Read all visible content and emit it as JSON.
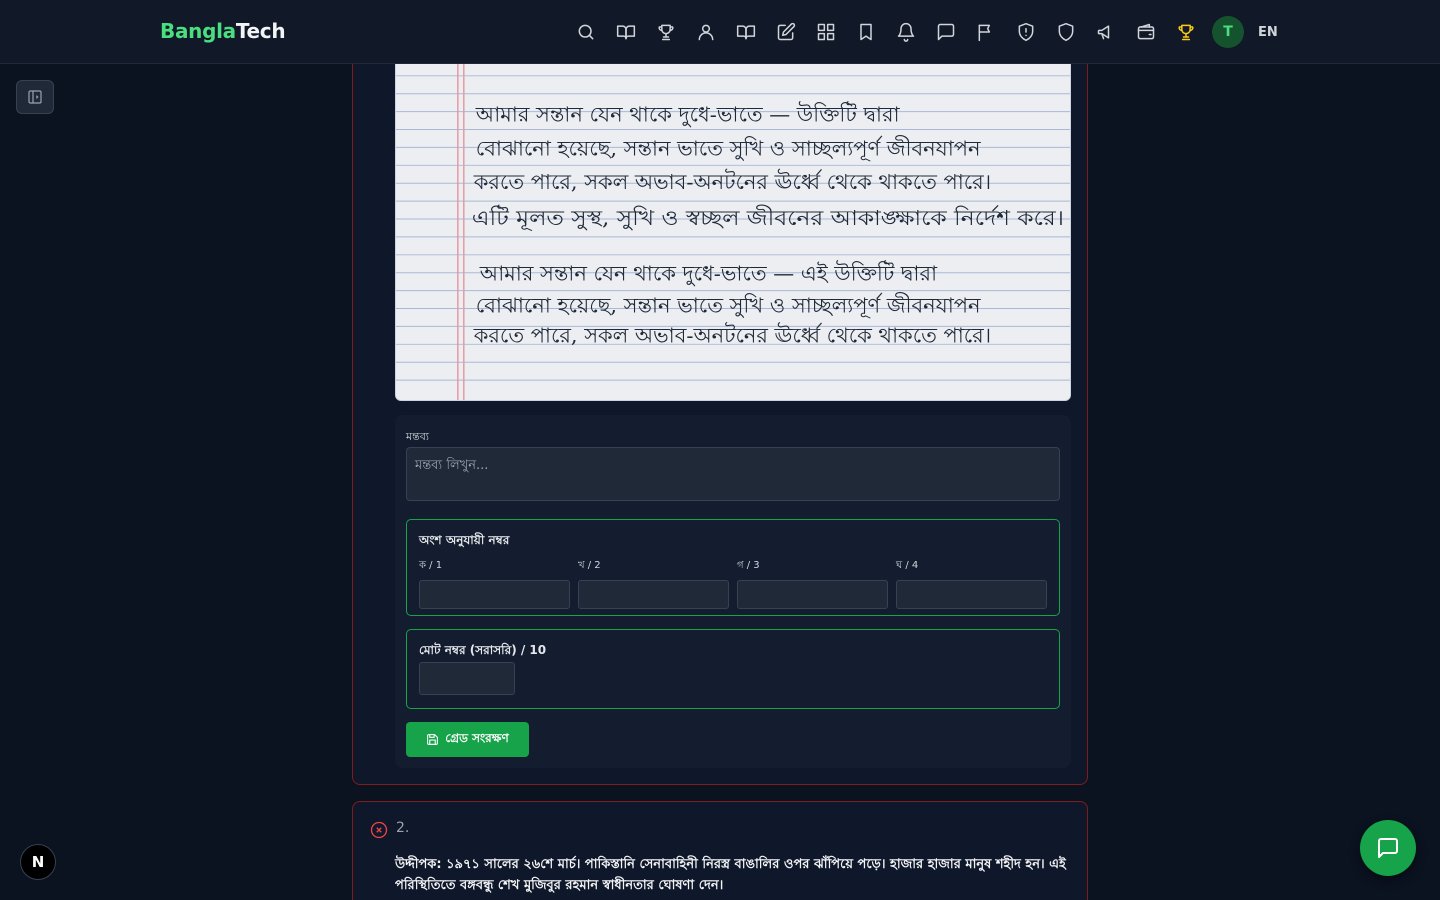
{
  "brand": {
    "part1": "Bangla",
    "part2": "Tech"
  },
  "nav": {
    "icons": [
      "search-icon",
      "book-open-icon",
      "trophy-icon",
      "users-icon",
      "book-open-icon",
      "edit-icon",
      "grid-icon",
      "bookmark-icon",
      "bell-icon",
      "message-icon",
      "flag-icon",
      "shield-alert-icon",
      "shield-icon",
      "megaphone-icon",
      "wallet-icon",
      "trophy-icon"
    ],
    "avatar_initial": "T",
    "language": "EN"
  },
  "answer": {
    "image_lines": [
      "আমার সন্তান যেন থাকে দুধে-ভাতে — উক্তিটি দ্বারা",
      "বোঝানো হয়েছে, সন্তান ভাতে সুখি ও সাচ্ছল্যপূর্ণ জীবনযাপন",
      "করতে পারে, সকল অভাব-অনটনের ঊর্ধ্বে থেকে থাকতে পারে।",
      "এটি মূলত সুস্থ, সুখি ও স্বচ্ছল জীবনের আকাঙ্ক্ষাকে নির্দেশ করে।",
      "আমার সন্তান যেন থাকে দুধে-ভাতে — এই উক্তিটি দ্বারা",
      "বোঝানো হয়েছে, সন্তান ভাতে সুখি ও সাচ্ছল্যপূর্ণ জীবনযাপন",
      "করতে পারে, সকল অভাব-অনটনের ঊর্ধ্বে থেকে থাকতে পারে।"
    ]
  },
  "grading": {
    "comment_label": "মন্তব্য",
    "comment_placeholder": "মন্তব্য লিখুন...",
    "parts_title": "অংশ অনুযায়ী নম্বর",
    "parts": [
      {
        "label": "ক / 1"
      },
      {
        "label": "খ / 2"
      },
      {
        "label": "গ / 3"
      },
      {
        "label": "ঘ / 4"
      }
    ],
    "total_label": "মোট নম্বর (সরাসরি) / 10",
    "save_label": "গ্রেড সংরক্ষণ"
  },
  "question2": {
    "number": "2.",
    "text": "উদ্দীপক: ১৯৭১ সালের ২৬শে মার্চ। পাকিস্তানি সেনাবাহিনী নিরস্ত্র বাঙালির ওপর ঝাঁপিয়ে পড়ে। হাজার হাজার মানুষ শহীদ হন। এই পরিস্থিতিতে বঙ্গবন্ধু শেখ মুজিবুর রহমান স্বাধীনতার ঘোষণা দেন।"
  },
  "badge_letter": "N",
  "colors": {
    "accent": "#16a34a",
    "brand_green": "#4ade80",
    "error": "#ef4444",
    "trophy": "#facc15"
  }
}
